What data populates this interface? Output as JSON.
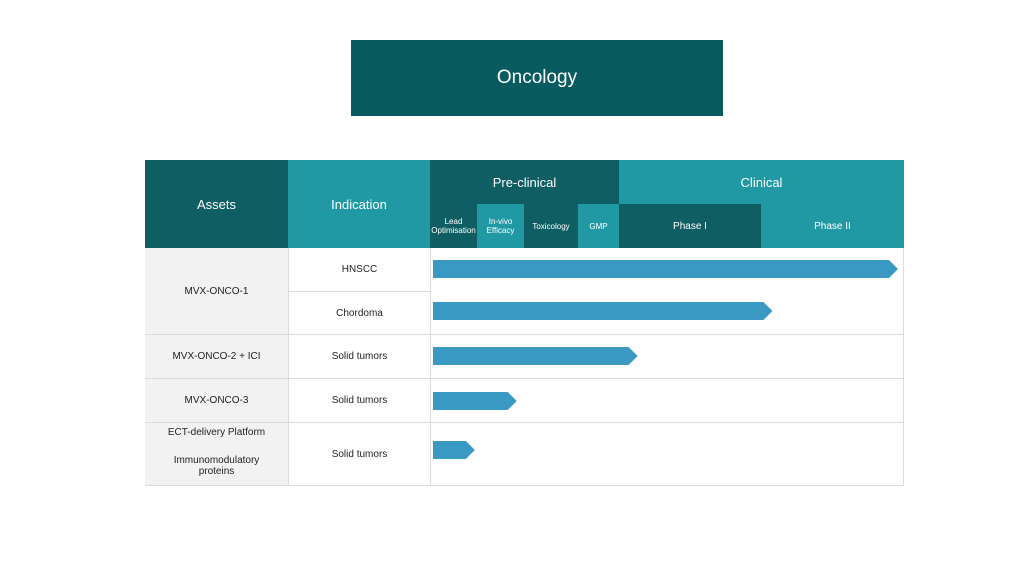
{
  "title": "Oncology",
  "headers": {
    "assets": "Assets",
    "indication": "Indication",
    "preclinical": "Pre-clinical",
    "clinical": "Clinical",
    "stages": [
      {
        "line1": "Lead",
        "line2": "Optimisation"
      },
      {
        "line1": "In-vivo",
        "line2": "Efficacy"
      },
      {
        "line1": "Toxicology",
        "line2": ""
      },
      {
        "line1": "GMP",
        "line2": ""
      },
      {
        "line1": "Phase I",
        "line2": ""
      },
      {
        "line1": "Phase II",
        "line2": ""
      }
    ]
  },
  "rows": [
    {
      "asset": "MVX-ONCO-1",
      "indications": [
        "HNSCC",
        "Chordoma"
      ]
    },
    {
      "asset": "MVX-ONCO-2 + ICI",
      "indications": [
        "Solid tumors"
      ]
    },
    {
      "asset": "MVX-ONCO-3",
      "indications": [
        "Solid tumors"
      ]
    },
    {
      "asset_line1": "ECT-delivery Platform",
      "asset_line2": "Immunomodulatory proteins",
      "indications": [
        "Solid tumors"
      ]
    }
  ],
  "progress": [
    1.0,
    0.73,
    0.44,
    0.18,
    0.09
  ],
  "colors": {
    "bar": "#3a99c3",
    "dark": "#0f5e63",
    "teal": "#2199a5"
  }
}
